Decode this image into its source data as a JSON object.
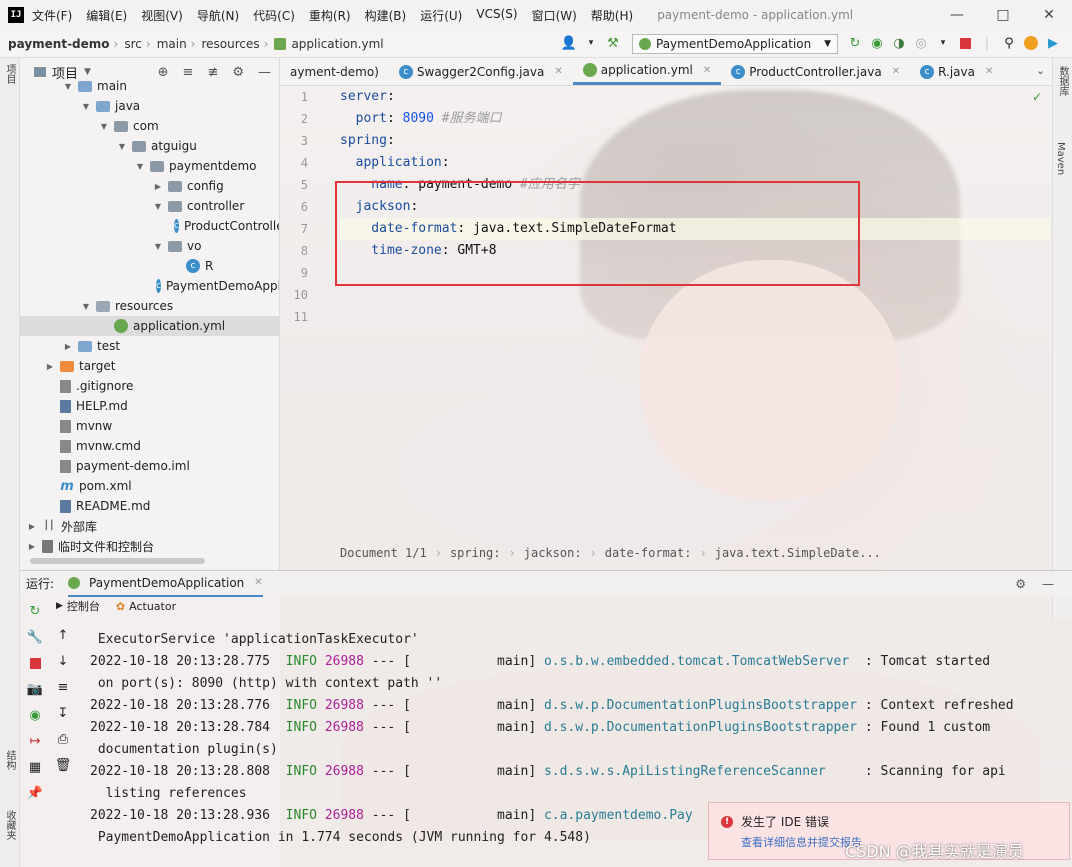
{
  "app": {
    "logo": "IJ",
    "window_title": "payment-demo - application.yml"
  },
  "menu": [
    "文件(F)",
    "编辑(E)",
    "视图(V)",
    "导航(N)",
    "代码(C)",
    "重构(R)",
    "构建(B)",
    "运行(U)",
    "VCS(S)",
    "窗口(W)",
    "帮助(H)"
  ],
  "breadcrumb": [
    "payment-demo",
    "src",
    "main",
    "resources",
    "application.yml"
  ],
  "run_config": "PaymentDemoApplication",
  "project_panel": {
    "title": "项目",
    "items": [
      {
        "label": "main",
        "depth": 3,
        "type": "folder"
      },
      {
        "label": "java",
        "depth": 4,
        "type": "folder"
      },
      {
        "label": "com",
        "depth": 5,
        "type": "package"
      },
      {
        "label": "atguigu",
        "depth": 6,
        "type": "package"
      },
      {
        "label": "paymentdemo",
        "depth": 7,
        "type": "package"
      },
      {
        "label": "config",
        "depth": 8,
        "type": "package"
      },
      {
        "label": "controller",
        "depth": 8,
        "type": "package"
      },
      {
        "label": "ProductController",
        "depth": 9,
        "type": "class"
      },
      {
        "label": "vo",
        "depth": 8,
        "type": "package"
      },
      {
        "label": "R",
        "depth": 9,
        "type": "class"
      },
      {
        "label": "PaymentDemoApplication",
        "depth": 8,
        "type": "class"
      },
      {
        "label": "resources",
        "depth": 4,
        "type": "resfolder"
      },
      {
        "label": "application.yml",
        "depth": 5,
        "type": "yml"
      },
      {
        "label": "test",
        "depth": 3,
        "type": "folder"
      },
      {
        "label": "target",
        "depth": 2,
        "type": "target"
      },
      {
        "label": ".gitignore",
        "depth": 2,
        "type": "file"
      },
      {
        "label": "HELP.md",
        "depth": 2,
        "type": "md"
      },
      {
        "label": "mvnw",
        "depth": 2,
        "type": "file"
      },
      {
        "label": "mvnw.cmd",
        "depth": 2,
        "type": "file"
      },
      {
        "label": "payment-demo.iml",
        "depth": 2,
        "type": "file"
      },
      {
        "label": "pom.xml",
        "depth": 2,
        "type": "pom"
      },
      {
        "label": "README.md",
        "depth": 2,
        "type": "md"
      },
      {
        "label": "外部库",
        "depth": 1,
        "type": "lib"
      },
      {
        "label": "临时文件和控制台",
        "depth": 1,
        "type": "scratch"
      }
    ]
  },
  "editor_tabs": [
    "ayment-demo)",
    "Swagger2Config.java",
    "application.yml",
    "ProductController.java",
    "R.java"
  ],
  "active_tab": "application.yml",
  "code_lines": [
    {
      "n": "1",
      "code": [
        {
          "t": "server",
          "c": "k"
        },
        {
          "t": ":",
          "c": "v"
        }
      ]
    },
    {
      "n": "2",
      "code": [
        {
          "t": "  port",
          "c": "k"
        },
        {
          "t": ": ",
          "c": "v"
        },
        {
          "t": "8090",
          "c": "n"
        },
        {
          "t": " #服务端口",
          "c": "c"
        }
      ]
    },
    {
      "n": "3",
      "code": [
        {
          "t": "spring",
          "c": "k"
        },
        {
          "t": ":",
          "c": "v"
        }
      ]
    },
    {
      "n": "4",
      "code": [
        {
          "t": "  application",
          "c": "k"
        },
        {
          "t": ":",
          "c": "v"
        }
      ]
    },
    {
      "n": "5",
      "code": [
        {
          "t": "    name",
          "c": "k"
        },
        {
          "t": ": payment-demo",
          "c": "v"
        },
        {
          "t": " #应用名字",
          "c": "c"
        }
      ]
    },
    {
      "n": "6",
      "code": [
        {
          "t": "  jackson",
          "c": "k"
        },
        {
          "t": ":",
          "c": "v"
        }
      ]
    },
    {
      "n": "7",
      "code": [
        {
          "t": "    date-format",
          "c": "k"
        },
        {
          "t": ": java.text.SimpleDateFormat",
          "c": "v"
        }
      ]
    },
    {
      "n": "8",
      "code": [
        {
          "t": "    time-zone",
          "c": "k"
        },
        {
          "t": ": GMT+8",
          "c": "v"
        }
      ]
    },
    {
      "n": "9",
      "code": []
    },
    {
      "n": "10",
      "code": []
    },
    {
      "n": "11",
      "code": []
    }
  ],
  "editor_breadcrumb": [
    "Document 1/1",
    "spring:",
    "jackson:",
    "date-format:",
    "java.text.SimpleDate..."
  ],
  "run_panel": {
    "label": "运行:",
    "tab": "PaymentDemoApplication",
    "subtabs": [
      "控制台",
      "Actuator"
    ]
  },
  "console_lines": [
    {
      "text": " ExecutorService 'applicationTaskExecutor'"
    },
    {
      "ts": "2022-10-18 20:13:28.775",
      "level": "INFO",
      "pid": "26988",
      "mid": " --- [           main] ",
      "logger": "o.s.b.w.embedded.tomcat.TomcatWebServer ",
      "msg": " : Tomcat started"
    },
    {
      "text": " on port(s): 8090 (http) with context path ''"
    },
    {
      "ts": "2022-10-18 20:13:28.776",
      "level": "INFO",
      "pid": "26988",
      "mid": " --- [           main] ",
      "logger": "d.s.w.p.DocumentationPluginsBootstrapper",
      "msg": " : Context refreshed"
    },
    {
      "ts": "2022-10-18 20:13:28.784",
      "level": "INFO",
      "pid": "26988",
      "mid": " --- [           main] ",
      "logger": "d.s.w.p.DocumentationPluginsBootstrapper",
      "msg": " : Found 1 custom"
    },
    {
      "text": " documentation plugin(s)"
    },
    {
      "ts": "2022-10-18 20:13:28.808",
      "level": "INFO",
      "pid": "26988",
      "mid": " --- [           main] ",
      "logger": "s.d.s.w.s.ApiListingReferenceScanner    ",
      "msg": " : Scanning for api"
    },
    {
      "text": "  listing references"
    },
    {
      "ts": "2022-10-18 20:13:28.936",
      "level": "INFO",
      "pid": "26988",
      "mid": " --- [           main] ",
      "logger": "c.a.paymentdemo.Pay",
      "msg": ""
    },
    {
      "text": " PaymentDemoApplication in 1.774 seconds (JVM running for 4.548)"
    }
  ],
  "notification": {
    "title": "发生了 IDE 错误",
    "link": "查看详细信息并提交报告"
  },
  "left_strip": [
    "项目",
    "结构",
    "收藏夹"
  ],
  "right_strip": [
    "数据库",
    "Maven"
  ],
  "watermark": "CSDN @我其实就是演员"
}
